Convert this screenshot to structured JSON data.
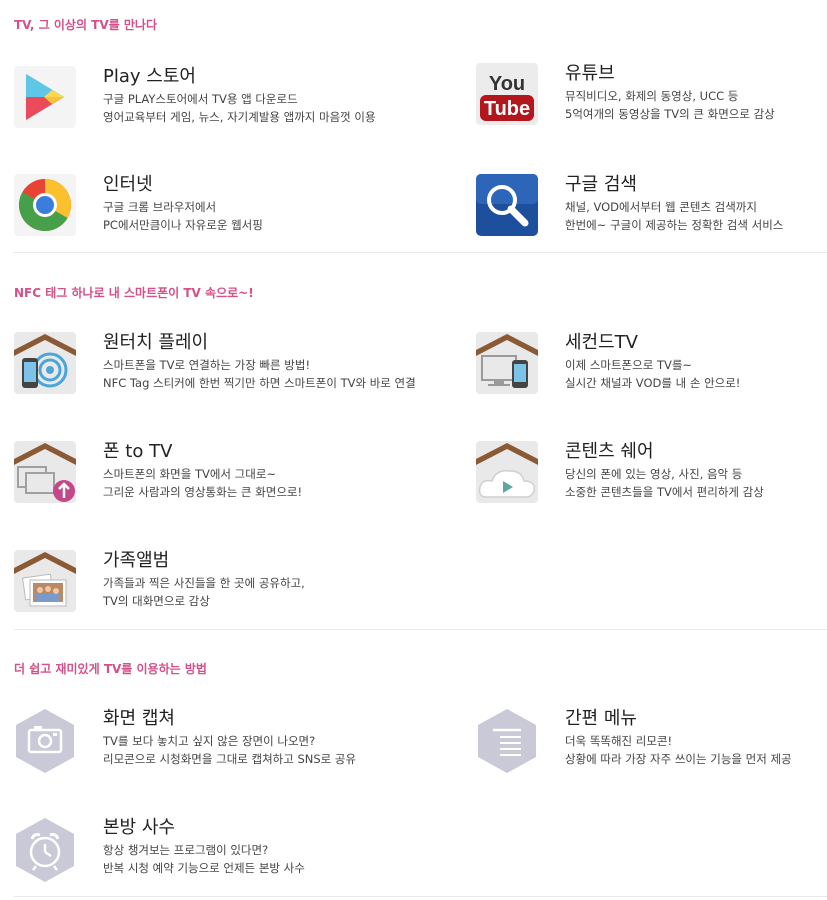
{
  "sections": [
    {
      "title": "TV, 그 이상의 TV를 만나다"
    },
    {
      "title": "NFC 태그 하나로 내 스마트폰이 TV 속으로~!"
    },
    {
      "title": "더 쉽고 재미있게 TV를 이용하는 방법"
    }
  ],
  "items": {
    "play": {
      "title": "Play 스토어",
      "line1": "구글 PLAY스토어에서 TV용 앱 다운로드",
      "line2": "영어교육부터 게임, 뉴스, 자기계발용 앱까지 마음껏 이용"
    },
    "youtube": {
      "title": "유튜브",
      "line1": "뮤직비디오, 화제의 동영상, UCC 등",
      "line2": "5억여개의 동영상을 TV의 큰 화면으로 감상",
      "icon_text1": "You",
      "icon_text2": "Tube"
    },
    "internet": {
      "title": "인터넷",
      "line1": "구글 크롬 브라우저에서",
      "line2": "PC에서만큼이나 자유로운 웹서핑"
    },
    "google": {
      "title": "구글 검색",
      "line1": "채널, VOD에서부터 웹 콘텐츠 검색까지",
      "line2": "한번에~ 구글이 제공하는 정확한 검색 서비스"
    },
    "onetouch": {
      "title": "원터치 플레이",
      "line1": "스마트폰을 TV로 연결하는 가장 빠른 방법!",
      "line2": "NFC Tag 스티커에 한번 찍기만 하면 스마트폰이 TV와 바로 연결"
    },
    "second": {
      "title": "세컨드TV",
      "line1": "이제 스마트폰으로 TV를~",
      "line2": "실시간 채널과 VOD를 내 손 안으로!"
    },
    "phonetotv": {
      "title": "폰 to TV",
      "line1": "스마트폰의 화면을 TV에서 그대로~",
      "line2": "그리운 사람과의 영상통화는 큰 화면으로!"
    },
    "share": {
      "title": "콘텐츠 쉐어",
      "line1": "당신의 폰에 있는 영상, 사진, 음악 등",
      "line2": "소중한 콘텐츠들을 TV에서 편리하게 감상"
    },
    "album": {
      "title": "가족앨범",
      "line1": "가족들과 찍은 사진들을 한 곳에 공유하고,",
      "line2": "TV의 대화면으로 감상"
    },
    "capture": {
      "title": "화면 캡쳐",
      "line1": "TV를 보다 놓치고 싶지 않은 장면이 나오면?",
      "line2": "리모콘으로 시청화면을 그대로 캡쳐하고 SNS로 공유"
    },
    "menu": {
      "title": "간편 메뉴",
      "line1": "더욱 똑똑해진 리모콘!",
      "line2": "상황에 따라 가장 자주 쓰이는 기능을 먼저 제공"
    },
    "alarm": {
      "title": "본방 사수",
      "line1": "항상 챙겨보는 프로그램이 있다면?",
      "line2": "반복 시청 예약 기능으로 언제든 본방 사수"
    }
  },
  "colors": {
    "accent": "#d4508a",
    "hexagon": "#c9c9d8",
    "divider": "#e8e8e8"
  },
  "icons": {
    "play": "play-store-icon",
    "youtube": "youtube-icon",
    "internet": "chrome-icon",
    "google": "search-icon",
    "onetouch": "nfc-phone-icon",
    "second": "monitor-phone-icon",
    "phonetotv": "screen-upload-icon",
    "share": "cloud-play-icon",
    "album": "photo-album-icon",
    "capture": "camera-icon",
    "menu": "menu-lines-icon",
    "alarm": "alarm-clock-icon"
  }
}
